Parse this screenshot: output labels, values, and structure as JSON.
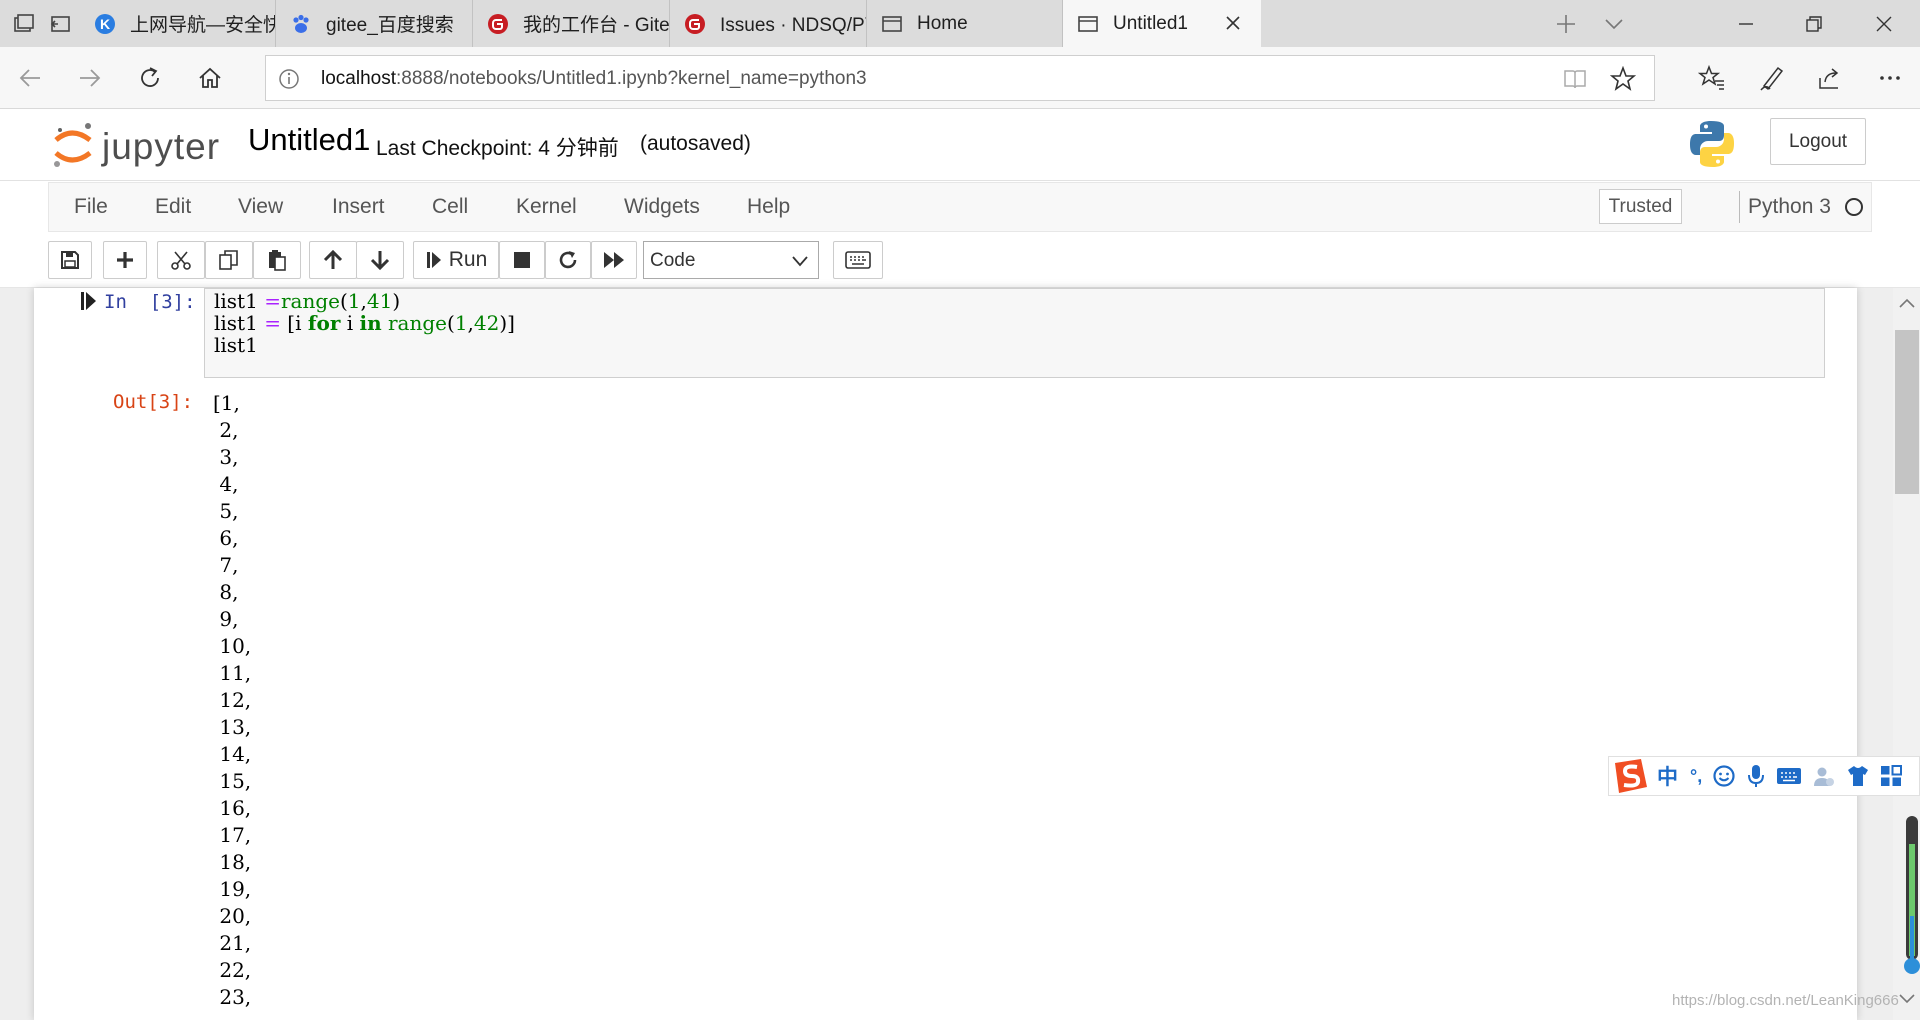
{
  "browser": {
    "tabs": [
      {
        "title": "上网导航—安全快捷",
        "favicon": "k-circle-icon"
      },
      {
        "title": "gitee_百度搜索",
        "favicon": "baidu-paw-icon"
      },
      {
        "title": "我的工作台 - Gitee.c",
        "favicon": "gitee-icon"
      },
      {
        "title": "Issues · NDSQ/PY作业",
        "favicon": "gitee-icon"
      },
      {
        "title": "Home",
        "favicon": "page-icon"
      },
      {
        "title": "Untitled1",
        "favicon": "page-icon",
        "active": true
      }
    ],
    "url_host": "localhost",
    "url_rest": ":8888/notebooks/Untitled1.ipynb?kernel_name=python3"
  },
  "jupyter": {
    "logo_text": "jupyter",
    "notebook_name": "Untitled1",
    "checkpoint": "Last Checkpoint: 4 分钟前",
    "autosave": "(autosaved)",
    "logout_label": "Logout",
    "menu": [
      "File",
      "Edit",
      "View",
      "Insert",
      "Cell",
      "Kernel",
      "Widgets",
      "Help"
    ],
    "trusted_label": "Trusted",
    "kernel_name": "Python 3",
    "toolbar": {
      "run_label": "Run",
      "cell_type": "Code"
    }
  },
  "cell": {
    "in_prompt": "In  [3]:",
    "out_prompt": "Out[3]:",
    "code": {
      "line1_a": "list1 ",
      "line1_op": "=",
      "line1_fn": "range",
      "line1_p1": "(",
      "line1_n1": "1",
      "line1_c": ",",
      "line1_n2": "41",
      "line1_p2": ")",
      "line2_a": "list1 ",
      "line2_op": "=",
      "line2_b": " [i ",
      "line2_kw1": "for",
      "line2_c": " i ",
      "line2_kw2": "in",
      "line2_sp": " ",
      "line2_fn": "range",
      "line2_p1": "(",
      "line2_n1": "1",
      "line2_cm": ",",
      "line2_n2": "42",
      "line2_p2": ")]",
      "line3": "list1"
    },
    "output_lines": [
      "[1,",
      " 2,",
      " 3,",
      " 4,",
      " 5,",
      " 6,",
      " 7,",
      " 8,",
      " 9,",
      " 10,",
      " 11,",
      " 12,",
      " 13,",
      " 14,",
      " 15,",
      " 16,",
      " 17,",
      " 18,",
      " 19,",
      " 20,",
      " 21,",
      " 22,",
      " 23,"
    ]
  },
  "ime": {
    "mode_char": "中",
    "punct": "°,"
  },
  "watermark": "https://blog.csdn.net/LeanKing666",
  "colors": {
    "jupyter_orange": "#f37726",
    "prompt_in": "#303f9f",
    "prompt_out": "#d84315",
    "ime_blue": "#1e6bc7",
    "sogou_orange": "#f04e23"
  }
}
